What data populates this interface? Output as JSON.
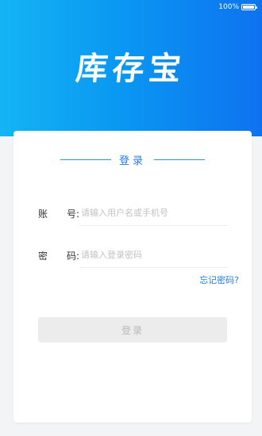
{
  "status_bar": {
    "battery_text": "100%"
  },
  "app": {
    "title": "库存宝"
  },
  "login": {
    "section_title": "登录",
    "account": {
      "label_first": "账",
      "label_second": "号",
      "placeholder": "请输入用户名或手机号",
      "value": ""
    },
    "password": {
      "label_first": "密",
      "label_second": "码",
      "placeholder": "请输入登录密码",
      "value": ""
    },
    "colon": ":",
    "forgot_password": "忘记密码?",
    "submit_label": "登录"
  },
  "colors": {
    "accent": "#1f7ce6",
    "header_gradient_start": "#14b4f4",
    "header_gradient_end": "#0e72f0",
    "button_disabled_bg": "#ececec",
    "button_disabled_text": "#b9b9b9"
  },
  "icons": {
    "battery": "battery-icon"
  }
}
